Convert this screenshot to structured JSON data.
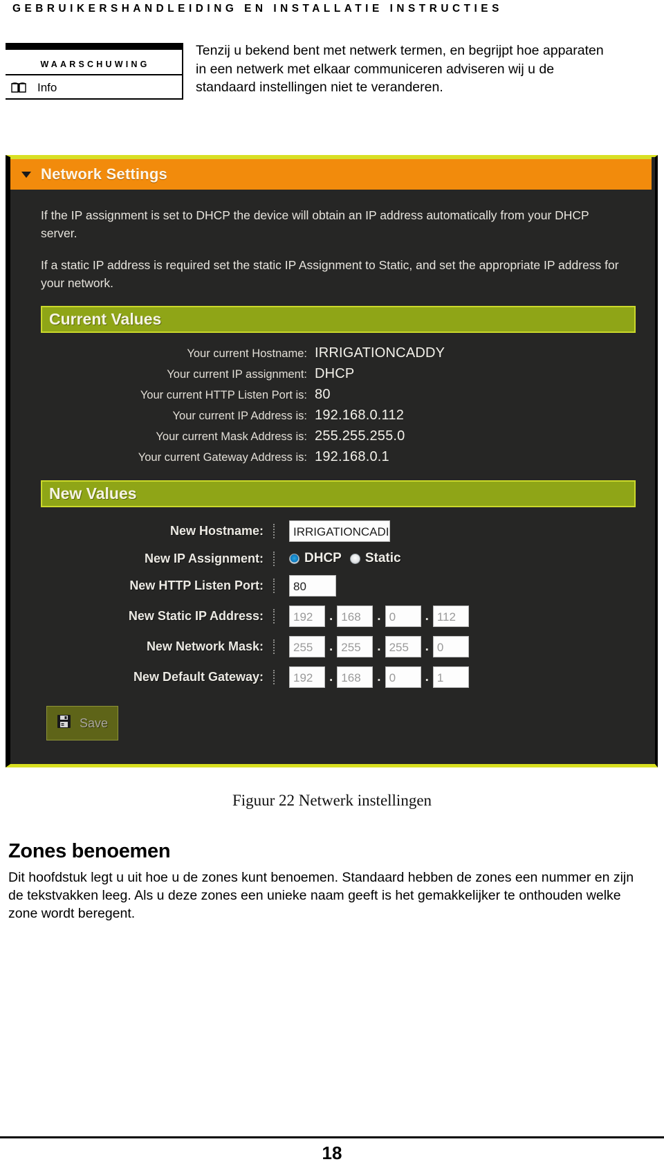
{
  "document": {
    "running_header": "GEBRUIKERSHANDLEIDING EN INSTALLATIE INSTRUCTIES",
    "page_number": "18"
  },
  "warning_box": {
    "title": "WAARSCHUWING",
    "info_label": "Info",
    "info_icon": "book-icon",
    "body": "Tenzij u bekend bent met netwerk termen, en begrijpt hoe apparaten in een netwerk met elkaar communiceren adviseren wij u de standaard instellingen niet te veranderen."
  },
  "figure": {
    "caption": "Figuur 22 Netwerk instellingen",
    "panel": {
      "title": "Network Settings",
      "collapse_icon": "chevron-down-icon",
      "header_color": "#f28b0c",
      "accent_color": "#d6de2a",
      "background_color": "#262625",
      "intro": [
        "If the IP assignment is set to DHCP the device will obtain an IP address automatically from your DHCP server.",
        "If a static IP address is required set the static IP Assignment to Static, and set the appropriate IP address for your network."
      ],
      "current_values": {
        "heading": "Current Values",
        "rows": [
          {
            "label": "Your current Hostname:",
            "value": "IRRIGATIONCADDY"
          },
          {
            "label": "Your current IP assignment:",
            "value": "DHCP"
          },
          {
            "label": "Your current HTTP Listen Port is:",
            "value": "80"
          },
          {
            "label": "Your current IP Address is:",
            "value": "192.168.0.112"
          },
          {
            "label": "Your current Mask Address is:",
            "value": "255.255.255.0"
          },
          {
            "label": "Your current Gateway Address is:",
            "value": "192.168.0.1"
          }
        ]
      },
      "new_values": {
        "heading": "New Values",
        "hostname": {
          "label": "New Hostname:",
          "value": "IRRIGATIONCADI"
        },
        "ip_assignment": {
          "label": "New IP Assignment:",
          "options": [
            {
              "label": "DHCP",
              "selected": true
            },
            {
              "label": "Static",
              "selected": false
            }
          ]
        },
        "http_port": {
          "label": "New HTTP Listen Port:",
          "value": "80"
        },
        "static_ip": {
          "label": "New Static IP Address:",
          "octets": [
            "192",
            "168",
            "0",
            "112"
          ],
          "separator": "."
        },
        "network_mask": {
          "label": "New Network Mask:",
          "octets": [
            "255",
            "255",
            "255",
            "0"
          ],
          "separator": "."
        },
        "default_gateway": {
          "label": "New Default Gateway:",
          "octets": [
            "192",
            "168",
            "0",
            "1"
          ],
          "separator": "."
        },
        "save_button": {
          "label": "Save",
          "icon": "save-disk-icon",
          "color": "#5e6418"
        }
      }
    }
  },
  "section": {
    "heading": "Zones benoemen",
    "body": "Dit hoofdstuk legt u uit hoe u de zones kunt benoemen. Standaard hebben de zones een nummer en zijn de tekstvakken leeg. Als u deze zones een unieke naam geeft is het gemakkelijker te onthouden welke zone wordt beregent."
  }
}
